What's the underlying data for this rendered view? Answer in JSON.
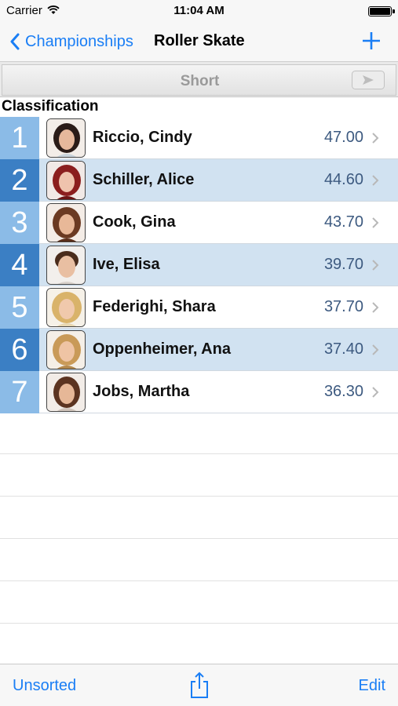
{
  "status_bar": {
    "carrier": "Carrier",
    "time": "11:04 AM"
  },
  "nav": {
    "back_label": "Championships",
    "title": "Roller Skate",
    "add_icon": "plus-icon"
  },
  "segment": {
    "label": "Short",
    "icon": "send-icon"
  },
  "section_header": "Classification",
  "rows": [
    {
      "rank": "1",
      "name": "Riccio, Cindy",
      "score": "47.00"
    },
    {
      "rank": "2",
      "name": "Schiller, Alice",
      "score": "44.60"
    },
    {
      "rank": "3",
      "name": "Cook, Gina",
      "score": "43.70"
    },
    {
      "rank": "4",
      "name": "Ive, Elisa",
      "score": "39.70"
    },
    {
      "rank": "5",
      "name": "Federighi, Shara",
      "score": "37.70"
    },
    {
      "rank": "6",
      "name": "Oppenheimer, Ana",
      "score": "37.40"
    },
    {
      "rank": "7",
      "name": "Jobs, Martha",
      "score": "36.30"
    }
  ],
  "toolbar": {
    "left_label": "Unsorted",
    "right_label": "Edit",
    "share_icon": "share-icon"
  },
  "colors": {
    "accent": "#1a7ef5",
    "rank_light": "#8bbbe7",
    "rank_dark": "#3b7fc4",
    "row_highlight": "#d1e2f1",
    "score_text": "#3d5a80"
  }
}
